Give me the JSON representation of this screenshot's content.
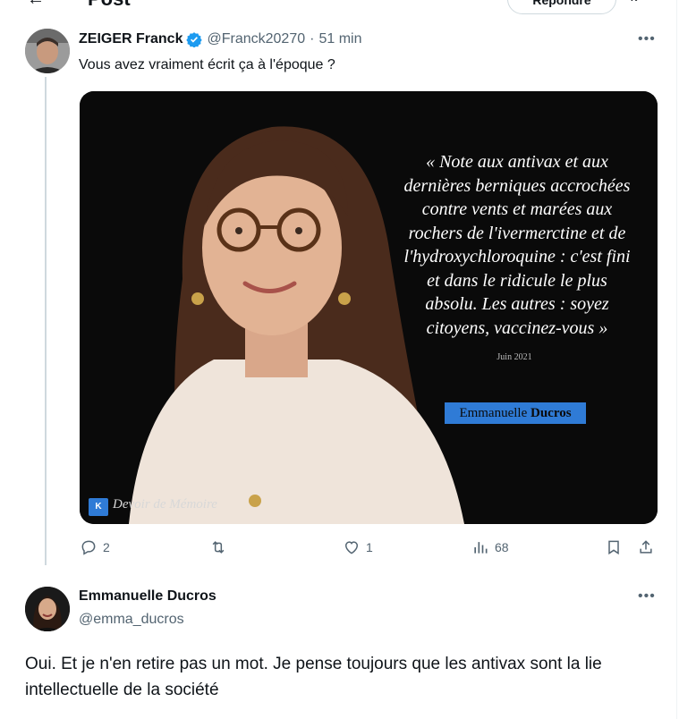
{
  "header": {
    "title": "Post",
    "reply_label": "Répondre"
  },
  "tweet1": {
    "author_name": "ZEIGER Franck",
    "handle": "@Franck20270",
    "separator": "·",
    "time": "51 min",
    "text": "Vous avez vraiment écrit ça à l'époque ?",
    "media": {
      "quote_lines": [
        "« Note aux antivax et aux",
        "dernières berniques accrochées",
        "contre vents et marées aux",
        "rochers de l'ivermerctine et de",
        "l'hydroxychloroquine : c'est fini",
        "et dans le ridicule le plus",
        "absolu. Les autres : soyez",
        "citoyens, vaccinez-vous »"
      ],
      "date": "Juin 2021",
      "name_tag_first": "Emmanuelle",
      "name_tag_last": "Ducros",
      "watermark_logo": "K",
      "watermark": "Devoir de Mémoire"
    },
    "actions": {
      "replies": "2",
      "likes": "1",
      "views": "68"
    }
  },
  "tweet2": {
    "author_name": "Emmanuelle Ducros",
    "handle": "@emma_ducros",
    "text": "Oui. Et je n'en retire pas un mot. Je pense toujours que les antivax sont la lie intellectuelle de la société"
  },
  "icons": {
    "more": "more-icon",
    "verified": "verified-badge-icon",
    "reply": "reply-icon",
    "retweet": "retweet-icon",
    "like": "like-icon",
    "views": "views-icon",
    "bookmark": "bookmark-icon",
    "share": "share-icon"
  },
  "colors": {
    "accent": "#1d9bf0",
    "muted": "#536471",
    "tag_blue": "#2f7bd6"
  }
}
